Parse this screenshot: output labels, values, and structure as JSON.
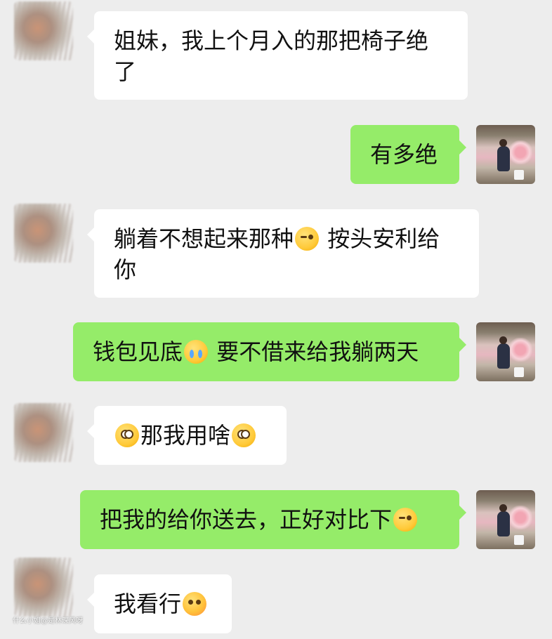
{
  "app": {
    "background_color": "#ededed",
    "incoming_bubble_color": "#ffffff",
    "outgoing_bubble_color": "#95ec69"
  },
  "messages": [
    {
      "direction": "incoming",
      "avatar": "blurred-contact-avatar",
      "parts": [
        "姐妹，我上个月入的那把椅子绝",
        "了"
      ]
    },
    {
      "direction": "outgoing",
      "avatar": "self-photo-avatar",
      "parts": [
        "有多绝"
      ]
    },
    {
      "direction": "incoming",
      "avatar": "blurred-contact-avatar",
      "parts": [
        "躺着不想起来那种",
        "按头安利给",
        "你"
      ],
      "emoji": [
        "wink-face-emoji"
      ]
    },
    {
      "direction": "outgoing",
      "avatar": "self-photo-avatar",
      "parts": [
        "钱包见底",
        "要不借来给我躺两天"
      ],
      "emoji": [
        "crying-face-emoji"
      ]
    },
    {
      "direction": "incoming",
      "avatar": "blurred-contact-avatar",
      "parts": [
        "那我用啥"
      ],
      "emoji": [
        "astonished-face-emoji",
        "staring-face-emoji"
      ]
    },
    {
      "direction": "outgoing",
      "avatar": "self-photo-avatar",
      "parts": [
        "把我的给你送去，正好对比下"
      ],
      "emoji": [
        "wink-face-emoji"
      ]
    },
    {
      "direction": "incoming",
      "avatar": "blurred-contact-avatar",
      "parts": [
        "我看行"
      ],
      "emoji": [
        "hand-over-mouth-face-emoji"
      ]
    }
  ],
  "watermark": "什么小姐@是林深风呀"
}
